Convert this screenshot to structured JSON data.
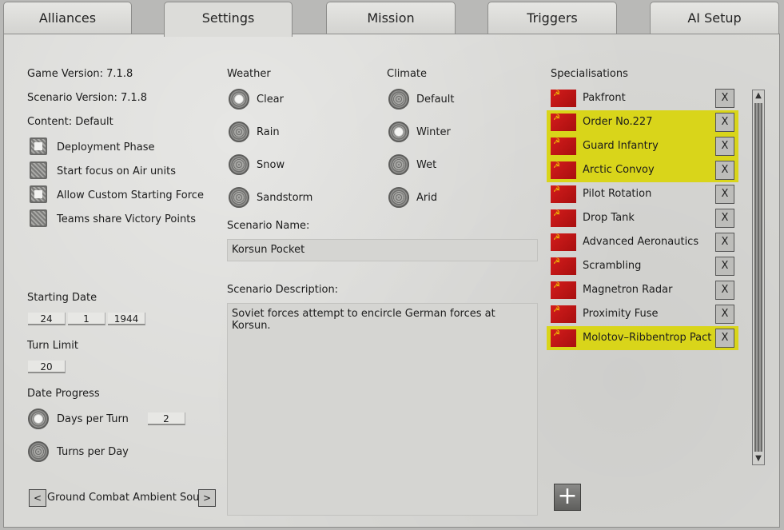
{
  "tabs": [
    {
      "label": "Alliances"
    },
    {
      "label": "Settings"
    },
    {
      "label": "Mission"
    },
    {
      "label": "Triggers"
    },
    {
      "label": "AI Setup"
    }
  ],
  "left": {
    "game_version": "Game Version: 7.1.8",
    "scenario_version": "Scenario Version: 7.1.8",
    "content": "Content: Default",
    "options": [
      {
        "label": "Deployment Phase",
        "checked": true
      },
      {
        "label": "Start focus on Air units",
        "checked": false
      },
      {
        "label": "Allow Custom Starting Force",
        "checked": true
      },
      {
        "label": "Teams share Victory Points",
        "checked": false
      }
    ],
    "starting_date_label": "Starting Date",
    "date": {
      "day": "24",
      "month": "1",
      "year": "1944"
    },
    "turn_limit_label": "Turn Limit",
    "turn_limit": "20",
    "date_progress_label": "Date Progress",
    "days_per_turn_label": "Days per Turn",
    "days_per_turn_value": "2",
    "turns_per_day_label": "Turns per Day",
    "ambient_sound_label": "Ground Combat Ambient Sound",
    "prev_symbol": "<",
    "next_symbol": ">"
  },
  "weather": {
    "title": "Weather",
    "options": [
      {
        "label": "Clear",
        "selected": true
      },
      {
        "label": "Rain",
        "selected": false
      },
      {
        "label": "Snow",
        "selected": false
      },
      {
        "label": "Sandstorm",
        "selected": false
      }
    ]
  },
  "climate": {
    "title": "Climate",
    "options": [
      {
        "label": "Default",
        "selected": false
      },
      {
        "label": "Winter",
        "selected": true
      },
      {
        "label": "Wet",
        "selected": false
      },
      {
        "label": "Arid",
        "selected": false
      }
    ]
  },
  "scenario": {
    "name_label": "Scenario Name:",
    "name": "Korsun Pocket",
    "description_label": "Scenario Description:",
    "description": "Soviet forces attempt to encircle German forces at Korsun."
  },
  "specialisations": {
    "title": "Specialisations",
    "remove_label": "X",
    "items": [
      {
        "label": "Pakfront",
        "highlighted": false
      },
      {
        "label": "Order No.227",
        "highlighted": true
      },
      {
        "label": "Guard Infantry",
        "highlighted": true
      },
      {
        "label": "Arctic Convoy",
        "highlighted": true
      },
      {
        "label": "Pilot Rotation",
        "highlighted": false
      },
      {
        "label": "Drop Tank",
        "highlighted": false
      },
      {
        "label": "Advanced Aeronautics",
        "highlighted": false
      },
      {
        "label": "Scrambling",
        "highlighted": false
      },
      {
        "label": "Magnetron Radar",
        "highlighted": false
      },
      {
        "label": "Proximity Fuse",
        "highlighted": false
      },
      {
        "label": "Molotov–Ribbentrop Pact",
        "highlighted": true
      }
    ],
    "add_symbol": "+"
  },
  "colors": {
    "highlight": "#d9d51a",
    "flag_red": "#c21414",
    "flag_emblem": "#f5d000"
  },
  "icons": {
    "flag": "soviet-flag-icon",
    "remove": "close-icon",
    "add": "plus-icon"
  }
}
